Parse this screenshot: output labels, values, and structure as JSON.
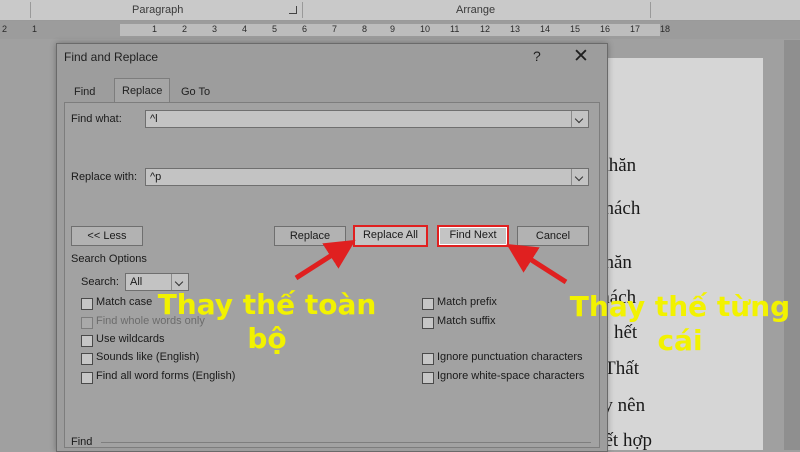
{
  "ribbon": {
    "paragraph_label": "Paragraph",
    "arrange_label": "Arrange"
  },
  "ruler": {
    "numbers": [
      "2",
      "1",
      "1",
      "2",
      "3",
      "4",
      "5",
      "6",
      "7",
      "8",
      "9",
      "10",
      "11",
      "12",
      "13",
      "14",
      "15",
      "16",
      "17",
      "18"
    ]
  },
  "document": {
    "lines": [
      "Khăn",
      "khách",
      "khăn",
      "thách",
      "n, hết",
      ". Thất",
      "ày nên",
      "kết hợp"
    ]
  },
  "dialog": {
    "title": "Find and Replace",
    "help_glyph": "?",
    "close_glyph": "✕",
    "tabs": [
      {
        "label": "Find",
        "active": false
      },
      {
        "label": "Replace",
        "active": true
      },
      {
        "label": "Go To",
        "active": false
      }
    ],
    "find_what": {
      "label": "Find what:",
      "value": "^l"
    },
    "replace_with": {
      "label": "Replace with:",
      "value": "^p"
    },
    "buttons": {
      "less": "<< Less",
      "replace": "Replace",
      "replace_all": "Replace All",
      "find_next": "Find Next",
      "cancel": "Cancel"
    },
    "search_options": {
      "title": "Search Options",
      "search_label": "Search:",
      "search_value": "All",
      "left_options": [
        {
          "label": "Match case",
          "disabled": false
        },
        {
          "label": "Find whole words only",
          "disabled": true
        },
        {
          "label": "Use wildcards",
          "disabled": false
        },
        {
          "label": "Sounds like (English)",
          "disabled": false
        },
        {
          "label": "Find all word forms (English)",
          "disabled": false
        }
      ],
      "right_options": [
        {
          "label": "Match prefix",
          "disabled": false
        },
        {
          "label": "Match suffix",
          "disabled": false
        },
        {
          "label": "Ignore punctuation characters",
          "disabled": false
        },
        {
          "label": "Ignore white-space characters",
          "disabled": false
        }
      ]
    },
    "bottom_section_label": "Find"
  },
  "annotations": {
    "left_line1": "Thay thế toàn",
    "left_line2": "bộ",
    "right_line1": "Thay thế từng",
    "right_line2": "cái",
    "text_color": "#f2f200",
    "arrow_color": "#e02020"
  }
}
